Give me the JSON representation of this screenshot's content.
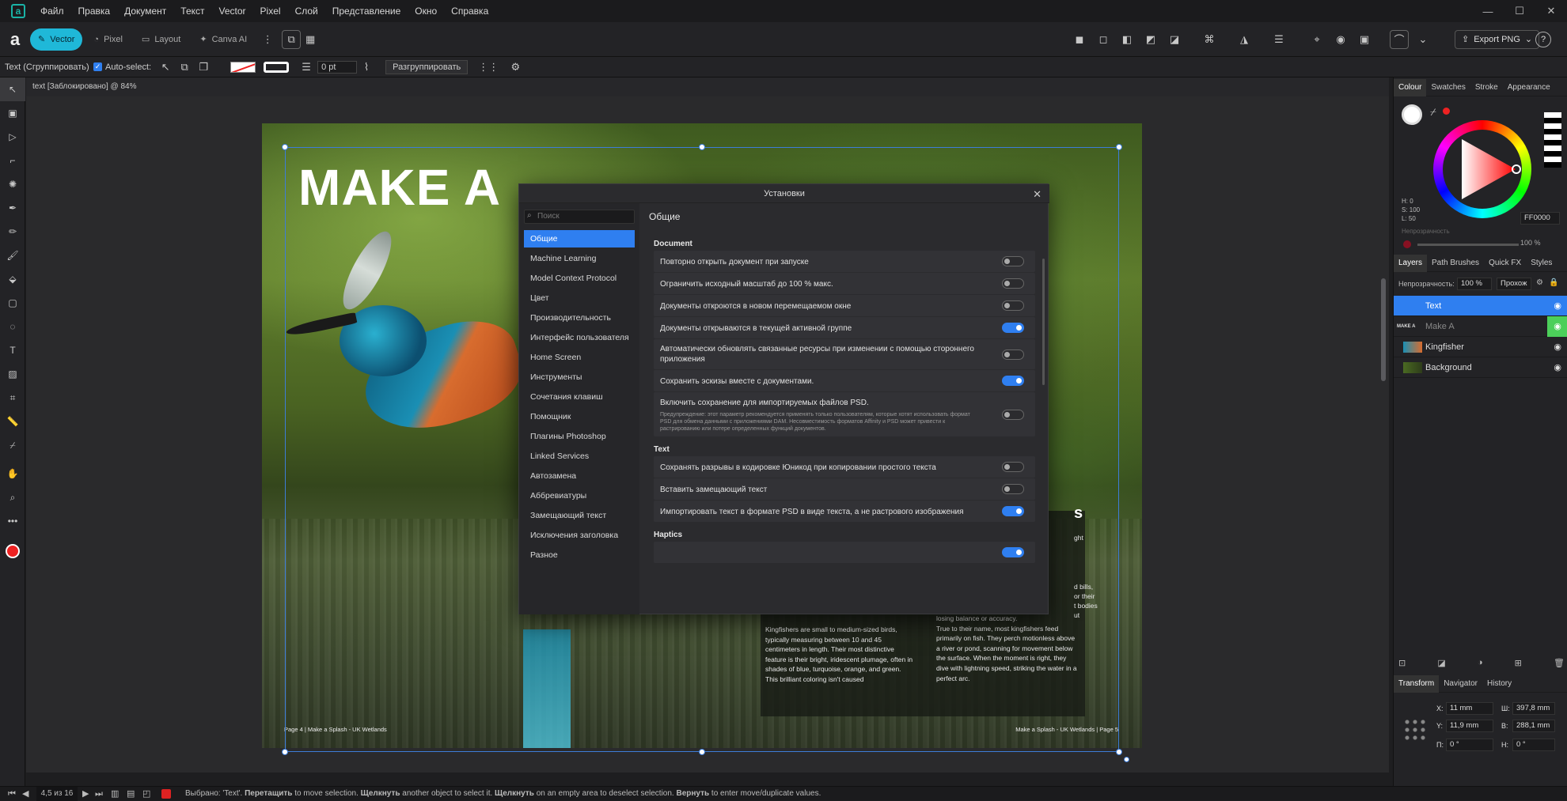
{
  "menubar": {
    "items": [
      "Файл",
      "Правка",
      "Документ",
      "Текст",
      "Vector",
      "Pixel",
      "Слой",
      "Представление",
      "Окно",
      "Справка"
    ]
  },
  "toolbar": {
    "personas": [
      {
        "label": "Vector",
        "active": true
      },
      {
        "label": "Pixel"
      },
      {
        "label": "Layout"
      },
      {
        "label": "Canva AI"
      }
    ],
    "export_label": "Export PNG"
  },
  "context": {
    "selection_label": "Text (Сгруппировать)",
    "autoselect_label": "Auto-select:",
    "stroke_width": "0 pt",
    "ungroup_label": "Разгруппировать"
  },
  "document": {
    "tab_title": "text [Заблокировано] @ 84%"
  },
  "artwork": {
    "title": "MAKE A",
    "textbox_heading_fragment": "s",
    "right_edge_fragments": [
      "ght",
      "d bills,",
      "or their",
      "t bodies",
      "ut"
    ],
    "col1": "Kingfishers are small to medium-sized birds, typically measuring between 10 and 45 centimeters in length. Their most distinctive feature is their bright, iridescent plumage, often in shades of blue, turquoise, orange, and green. This brilliant coloring isn't caused",
    "col2": "losing balance or accuracy.\n True to their name, most kingfishers feed primarily on fish. They perch motionless above a river or pond, scanning for movement below the surface. When the moment is right, they dive with lightning speed, striking the water in a perfect arc.",
    "footer_left": "Page 4  |  Make a Splash - UK Wetlands",
    "footer_right": "Make a Splash - UK Wetlands  |  Page 5"
  },
  "dialog": {
    "title": "Установки",
    "search_placeholder": "Поиск",
    "heading": "Общие",
    "categories": [
      "Общие",
      "Machine Learning",
      "Model Context Protocol",
      "Цвет",
      "Производительность",
      "Интерфейс пользователя",
      "Home Screen",
      "Инструменты",
      "Сочетания клавиш",
      "Помощник",
      "Плагины Photoshop",
      "Linked Services",
      "Автозамена",
      "Аббревиатуры",
      "Замещающий текст",
      "Исключения заголовка",
      "Разное"
    ],
    "sections": {
      "document": "Document",
      "text": "Text",
      "haptics": "Haptics"
    },
    "settings": [
      {
        "label": "Повторно открыть документ при запуске",
        "on": false
      },
      {
        "label": "Ограничить исходный масштаб до 100 % макс.",
        "on": false
      },
      {
        "label": "Документы откроются в новом перемещаемом окне",
        "on": false
      },
      {
        "label": "Документы открываются в текущей активной группе",
        "on": true
      },
      {
        "label": "Автоматически обновлять связанные ресурсы при изменении с помощью стороннего приложения",
        "on": false
      },
      {
        "label": "Сохранить эскизы вместе с документами.",
        "on": true
      },
      {
        "label": "Включить сохранение для импортируемых файлов PSD.",
        "note": "Предупреждение: этот параметр рекомендуется применять только пользователям, которые хотят использовать формат PSD для обмена данными с приложениями DAM. Несовместимость форматов Affinity и PSD может привести к растрированию или потере определенных функций документов.",
        "on": false
      },
      {
        "label": "Сохранять разрывы в кодировке Юникод при копировании простого текста",
        "on": false
      },
      {
        "label": "Вставить замещающий текст",
        "on": false
      },
      {
        "label": "Импортировать текст в формате PSD в виде текста, а не растрового изображения",
        "on": true
      }
    ]
  },
  "colour_panel": {
    "tabs": [
      "Colour",
      "Swatches",
      "Stroke",
      "Appearance"
    ],
    "h": "H: 0",
    "s": "S: 100",
    "l": "L: 50",
    "hex": "FF0000",
    "opacity_label": "Непрозрачность",
    "opacity_value": "100 %"
  },
  "layers_panel": {
    "tabs": [
      "Layers",
      "Path Brushes",
      "Quick FX",
      "Styles"
    ],
    "opacity_label": "Непрозрачность:",
    "opacity_value": "100 %",
    "blend": "Прохож",
    "layers": [
      {
        "name": "Text",
        "selected": true
      },
      {
        "name": "Make A",
        "thumb_text": "MAKE A"
      },
      {
        "name": "Kingfisher"
      },
      {
        "name": "Background"
      }
    ]
  },
  "transform_panel": {
    "tabs": [
      "Transform",
      "Navigator",
      "History"
    ],
    "x_label": "X:",
    "x": "11 mm",
    "y_label": "Y:",
    "y": "11,9 mm",
    "w_label": "Ш:",
    "w": "397,8 mm",
    "h_label": "В:",
    "h": "288,1 mm",
    "r_label": "П:",
    "r": "0 °",
    "s_label": "Н:",
    "s": "0 °"
  },
  "status": {
    "page_counter": "4,5 из 16",
    "message_pre": "Выбрано: 'Text'. ",
    "drag": "Перетащить",
    "t1": " to move selection. ",
    "click": "Щелкнуть",
    "t2": " another object to select it. ",
    "click2": "Щелкнуть",
    "t3": " on an empty area to deselect selection. ",
    "revert": "Вернуть",
    "t4": " to enter move/duplicate values."
  },
  "colors": {
    "accent": "#2f7ff0",
    "persona": "#1fb8d8",
    "red": "#ff0000"
  }
}
